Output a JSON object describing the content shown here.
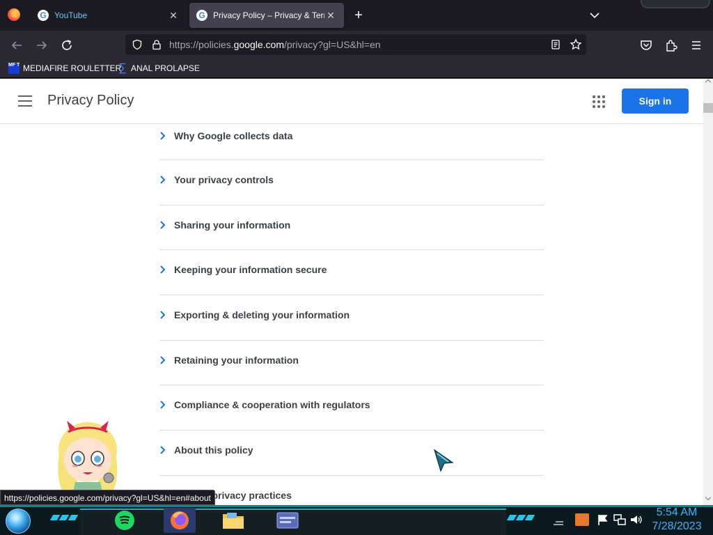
{
  "browser": {
    "tabs": [
      {
        "title": "YouTube",
        "favicon": "google-g-icon"
      },
      {
        "title": "Privacy Policy – Privacy & Terms – Google",
        "favicon": "google-g-icon",
        "active": true
      }
    ],
    "url_prefix": "https://policies.",
    "url_domain": "google.com",
    "url_suffix": "/privacy?gl=US&hl=en",
    "bookmarks": [
      {
        "label": "MEDIAFIRE ROULETTER",
        "icon_text": "MF T"
      },
      {
        "label": "ANAL PROLAPSE",
        "icon": "sigma-icon"
      }
    ]
  },
  "page": {
    "title": "Privacy Policy",
    "sign_in_label": "Sign in",
    "sections": [
      "Why Google collects data",
      "Your privacy controls",
      "Sharing your information",
      "Keeping your information secure",
      "Exporting & deleting your information",
      "Retaining your information",
      "Compliance & cooperation with regulators",
      "About this policy",
      "Related privacy practices"
    ],
    "status_link": "https://policies.google.com/privacy?gl=US&hl=en#about"
  },
  "taskbar": {
    "time": "5:54 AM",
    "date": "7/28/2023"
  },
  "colors": {
    "accent": "#1a73e8",
    "chevron": "#1a73e8",
    "clock": "#36b6ff"
  }
}
